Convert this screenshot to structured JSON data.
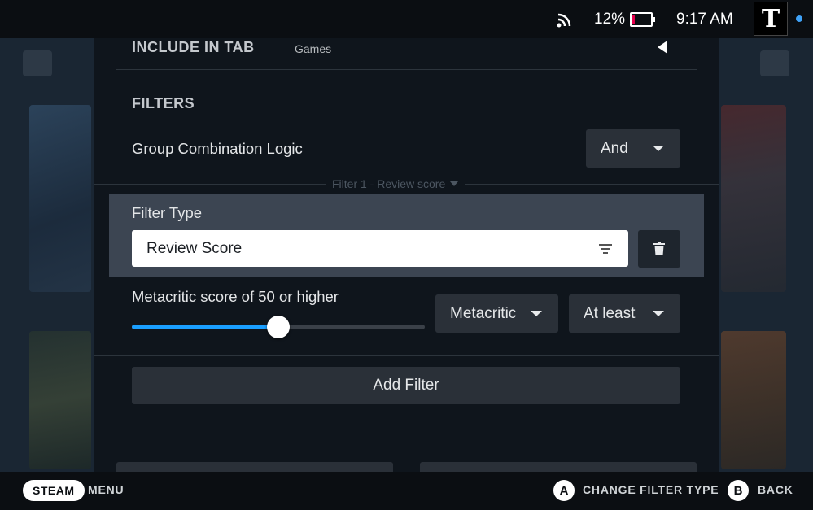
{
  "status": {
    "battery_percent": "12%",
    "battery_level": 0.12,
    "time": "9:17 AM",
    "avatar_letter": "T",
    "colors": {
      "online": "#3fa2f8",
      "battery_low": "#e5004d"
    }
  },
  "include_tab": {
    "title": "INCLUDE IN TAB",
    "value": "Games"
  },
  "filters": {
    "title": "FILTERS",
    "group_logic_label": "Group Combination Logic",
    "group_logic_value": "And",
    "filter1_separator": "Filter 1 - Review score",
    "filter_type_label": "Filter Type",
    "filter_type_value": "Review Score",
    "score_label": "Metacritic score of 50 or higher",
    "score_value": 50,
    "score_source": "Metacritic",
    "comparison": "At least",
    "add_filter_label": "Add Filter"
  },
  "footer": {
    "steam_label": "STEAM",
    "menu_label": "MENU",
    "a_glyph": "A",
    "a_action": "CHANGE FILTER TYPE",
    "b_glyph": "B",
    "b_action": "BACK"
  },
  "colors": {
    "accent": "#1a9fff",
    "panel": "#0f151c",
    "highlight": "#3c4552"
  }
}
